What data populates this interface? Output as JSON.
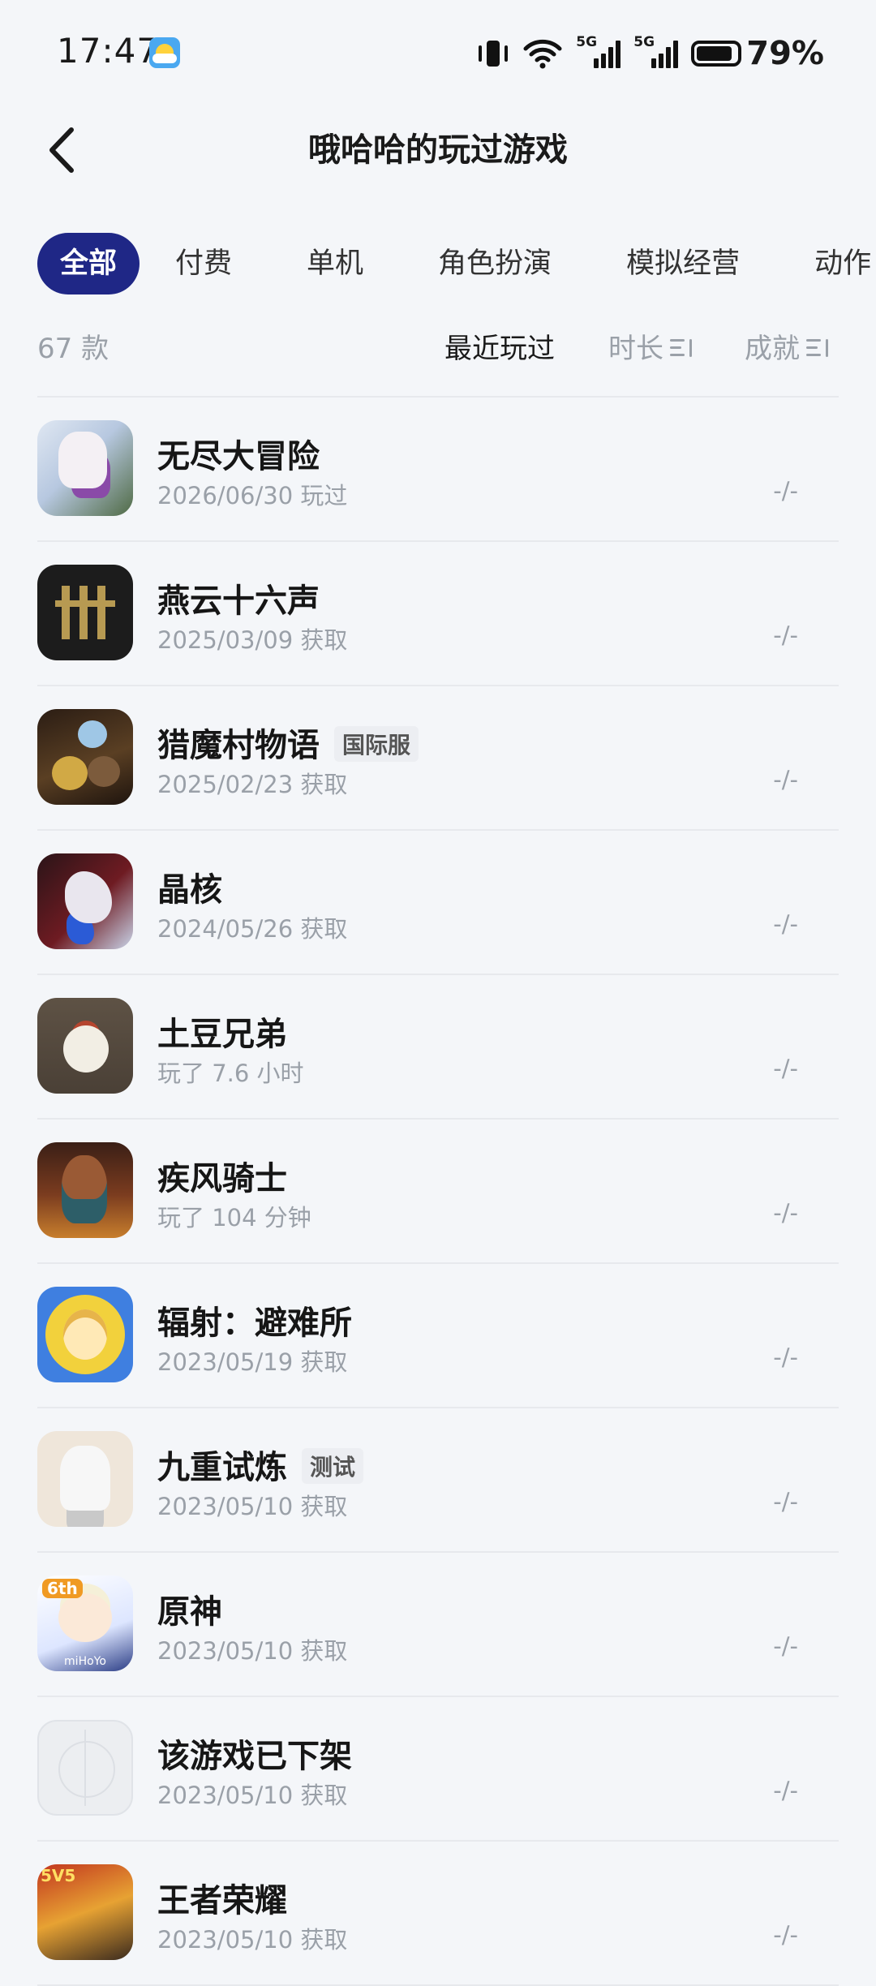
{
  "status_bar": {
    "time": "17:47",
    "battery": "79%",
    "network_1": "5G",
    "network_2": "5G",
    "battery_level": 0.79
  },
  "header": {
    "title": "哦哈哈的玩过游戏"
  },
  "tabs": [
    {
      "label": "全部",
      "active": true
    },
    {
      "label": "付费",
      "active": false
    },
    {
      "label": "单机",
      "active": false
    },
    {
      "label": "角色扮演",
      "active": false
    },
    {
      "label": "模拟经营",
      "active": false
    },
    {
      "label": "动作",
      "active": false
    }
  ],
  "sort_bar": {
    "count": "67 款",
    "recent": "最近玩过",
    "duration": "时长",
    "achievement": "成就"
  },
  "games": [
    {
      "name": "无尽大冒险",
      "badge": "",
      "sub": "2026/06/30 玩过",
      "achievement": "-/-",
      "icon": "endless-adventure-icon"
    },
    {
      "name": "燕云十六声",
      "badge": "",
      "sub": "2025/03/09 获取",
      "achievement": "-/-",
      "icon": "yanyun-icon"
    },
    {
      "name": "猎魔村物语",
      "badge": "国际服",
      "sub": "2025/02/23 获取",
      "achievement": "-/-",
      "icon": "monster-village-icon"
    },
    {
      "name": "晶核",
      "badge": "",
      "sub": "2024/05/26 获取",
      "achievement": "-/-",
      "icon": "crystal-core-icon"
    },
    {
      "name": "土豆兄弟",
      "badge": "",
      "sub": "玩了 7.6 小时",
      "achievement": "-/-",
      "icon": "brotato-icon"
    },
    {
      "name": "疾风骑士",
      "badge": "",
      "sub": "玩了 104 分钟",
      "achievement": "-/-",
      "icon": "gale-knight-icon"
    },
    {
      "name": "辐射：避难所",
      "badge": "",
      "sub": "2023/05/19 获取",
      "achievement": "-/-",
      "icon": "fallout-shelter-icon"
    },
    {
      "name": "九重试炼",
      "badge": "测试",
      "sub": "2023/05/10 获取",
      "achievement": "-/-",
      "icon": "nine-trials-icon"
    },
    {
      "name": "原神",
      "badge": "",
      "sub": "2023/05/10 获取",
      "achievement": "-/-",
      "icon": "genshin-icon"
    },
    {
      "name": "该游戏已下架",
      "badge": "",
      "sub": "2023/05/10 获取",
      "achievement": "-/-",
      "icon": "placeholder-game-icon"
    },
    {
      "name": "王者荣耀",
      "badge": "",
      "sub": "2023/05/10 获取",
      "achievement": "-/-",
      "icon": "honor-of-kings-icon"
    }
  ]
}
